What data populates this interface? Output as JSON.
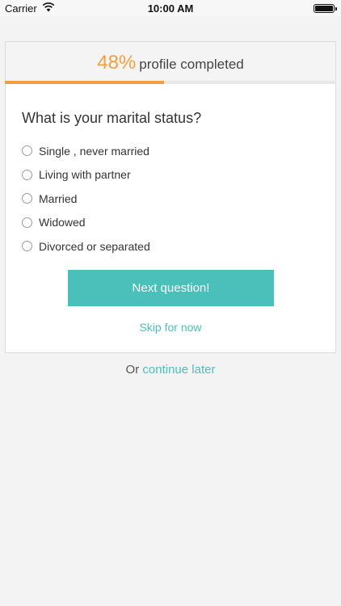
{
  "status_bar": {
    "carrier": "Carrier",
    "time": "10:00 AM"
  },
  "progress": {
    "percent_text": "48%",
    "label": "profile completed",
    "fraction": 0.48,
    "accent_color": "#f0a043"
  },
  "question": {
    "title": "What is your marital status?",
    "options": [
      "Single , never married",
      "Living with partner",
      "Married",
      "Widowed",
      "Divorced or separated"
    ]
  },
  "actions": {
    "next_label": "Next question!",
    "skip_label": "Skip for now",
    "continue_prefix": "Or",
    "continue_link": "continue later",
    "accent_color": "#4bbfb9"
  }
}
